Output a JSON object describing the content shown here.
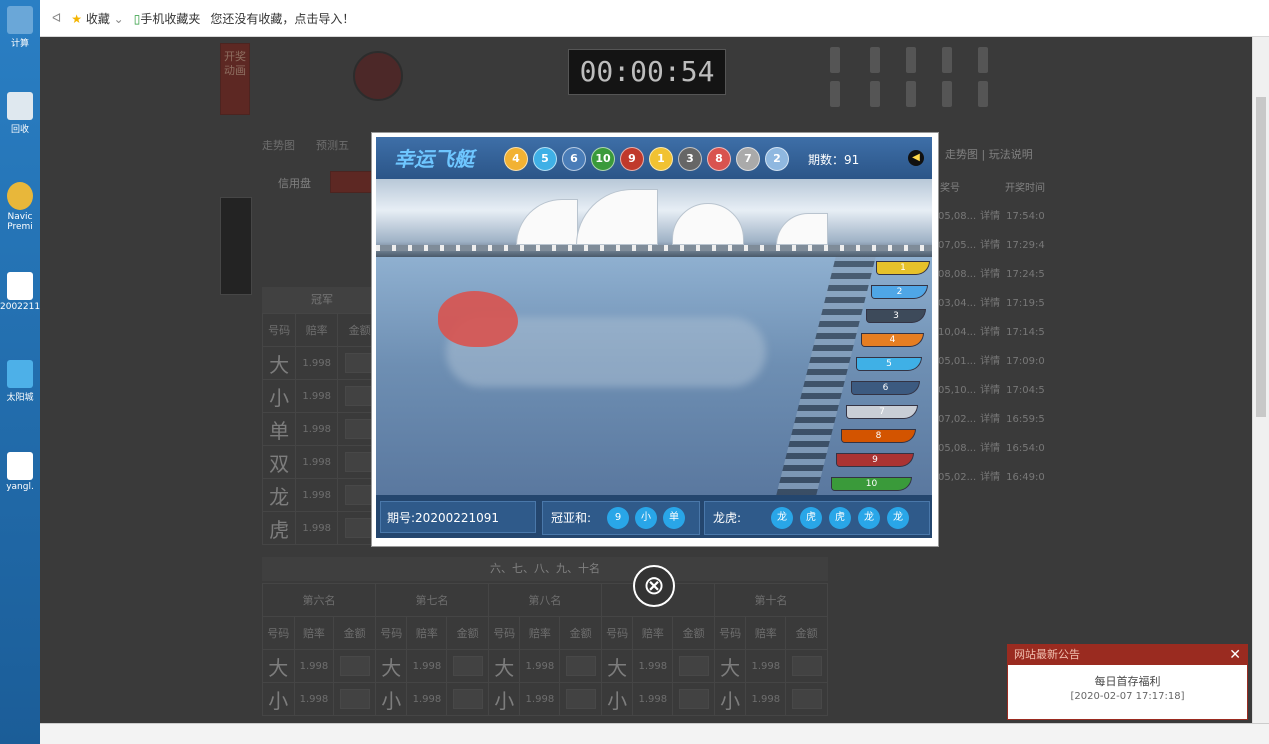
{
  "desktop": {
    "icons": [
      {
        "label": "计算"
      },
      {
        "label": "回收"
      },
      {
        "label": "Navic Premi"
      },
      {
        "label": "2002211"
      },
      {
        "label": "太阳城"
      },
      {
        "label": "yangl."
      }
    ]
  },
  "favbar": {
    "back": "ᐊ",
    "favorites": "收藏",
    "mobile_favorites": "手机收藏夹",
    "import_prompt": "您还没有收藏，点击导入！"
  },
  "game": {
    "open_anim_btn": "开奖动画",
    "timer": "00:00:54",
    "tabs": [
      "走势图",
      "预测五"
    ],
    "credit_label": "信用盘",
    "left_box_caption": "冠军",
    "headers": [
      "号码",
      "赔率",
      "金额"
    ],
    "rows": [
      {
        "label": "大",
        "odds": "1.998"
      },
      {
        "label": "小",
        "odds": "1.998"
      },
      {
        "label": "单",
        "odds": "1.998"
      },
      {
        "label": "双",
        "odds": "1.998"
      },
      {
        "label": "龙",
        "odds": "1.998"
      },
      {
        "label": "虎",
        "odds": "1.998"
      }
    ],
    "lower_title": "六、七、八、九、十名",
    "lower_groups": [
      "第六名",
      "第七名",
      "第八名",
      "",
      "第十名"
    ],
    "lower_rows": [
      {
        "label": "大",
        "odds": "1.998"
      },
      {
        "label": "小",
        "odds": "1.998"
      }
    ],
    "right_links": "走势图 | 玩法说明",
    "right_headers": [
      "奖号",
      "开奖时间"
    ],
    "lottery_rows": [
      {
        "no": "05,08...",
        "detail": "详情",
        "time": "17:54:0"
      },
      {
        "no": "07,05...",
        "detail": "详情",
        "time": "17:29:4"
      },
      {
        "no": "08,08...",
        "detail": "详情",
        "time": "17:24:5"
      },
      {
        "no": "03,04...",
        "detail": "详情",
        "time": "17:19:5"
      },
      {
        "no": "10,04...",
        "detail": "详情",
        "time": "17:14:5"
      },
      {
        "no": "05,01...",
        "detail": "详情",
        "time": "17:09:0"
      },
      {
        "no": "05,10...",
        "detail": "详情",
        "time": "17:04:5"
      },
      {
        "no": "07,02...",
        "detail": "详情",
        "time": "16:59:5"
      },
      {
        "no": "05,08...",
        "detail": "详情",
        "time": "16:54:0"
      },
      {
        "no": "05,02...",
        "detail": "详情",
        "time": "16:49:0"
      }
    ]
  },
  "modal": {
    "title": "幸运飞艇",
    "balls": [
      {
        "n": "4",
        "color": "#f2b233"
      },
      {
        "n": "5",
        "color": "#3fb0e6"
      },
      {
        "n": "6",
        "color": "#4a7db8"
      },
      {
        "n": "10",
        "color": "#3a9a3a"
      },
      {
        "n": "9",
        "color": "#c0392b"
      },
      {
        "n": "1",
        "color": "#f1c232"
      },
      {
        "n": "3",
        "color": "#666666"
      },
      {
        "n": "8",
        "color": "#d9534f"
      },
      {
        "n": "7",
        "color": "#aaaaaa"
      },
      {
        "n": "2",
        "color": "#8fb8e0"
      }
    ],
    "period": "期数：91",
    "boats": [
      {
        "n": "1",
        "color": "#e6c12a"
      },
      {
        "n": "2",
        "color": "#4fa6e6"
      },
      {
        "n": "3",
        "color": "#3d4a5a"
      },
      {
        "n": "4",
        "color": "#e67e22"
      },
      {
        "n": "5",
        "color": "#3fb0e6"
      },
      {
        "n": "6",
        "color": "#3c5a80"
      },
      {
        "n": "7",
        "color": "#c9ced6"
      },
      {
        "n": "8",
        "color": "#d35400"
      },
      {
        "n": "9",
        "color": "#a33"
      },
      {
        "n": "10",
        "color": "#3a9a3a"
      }
    ],
    "issue": "期号:20200221091",
    "sum_label": "冠亚和:",
    "sum_balls": [
      "9",
      "小",
      "单"
    ],
    "dragon_label": "龙虎:",
    "dragon_balls": [
      "龙",
      "虎",
      "虎",
      "龙",
      "龙"
    ]
  },
  "notice": {
    "header": "网站最新公告",
    "close": "✕",
    "title": "每日首存福利",
    "date": "[2020-02-07 17:17:18]"
  },
  "close_icon": "⊗"
}
